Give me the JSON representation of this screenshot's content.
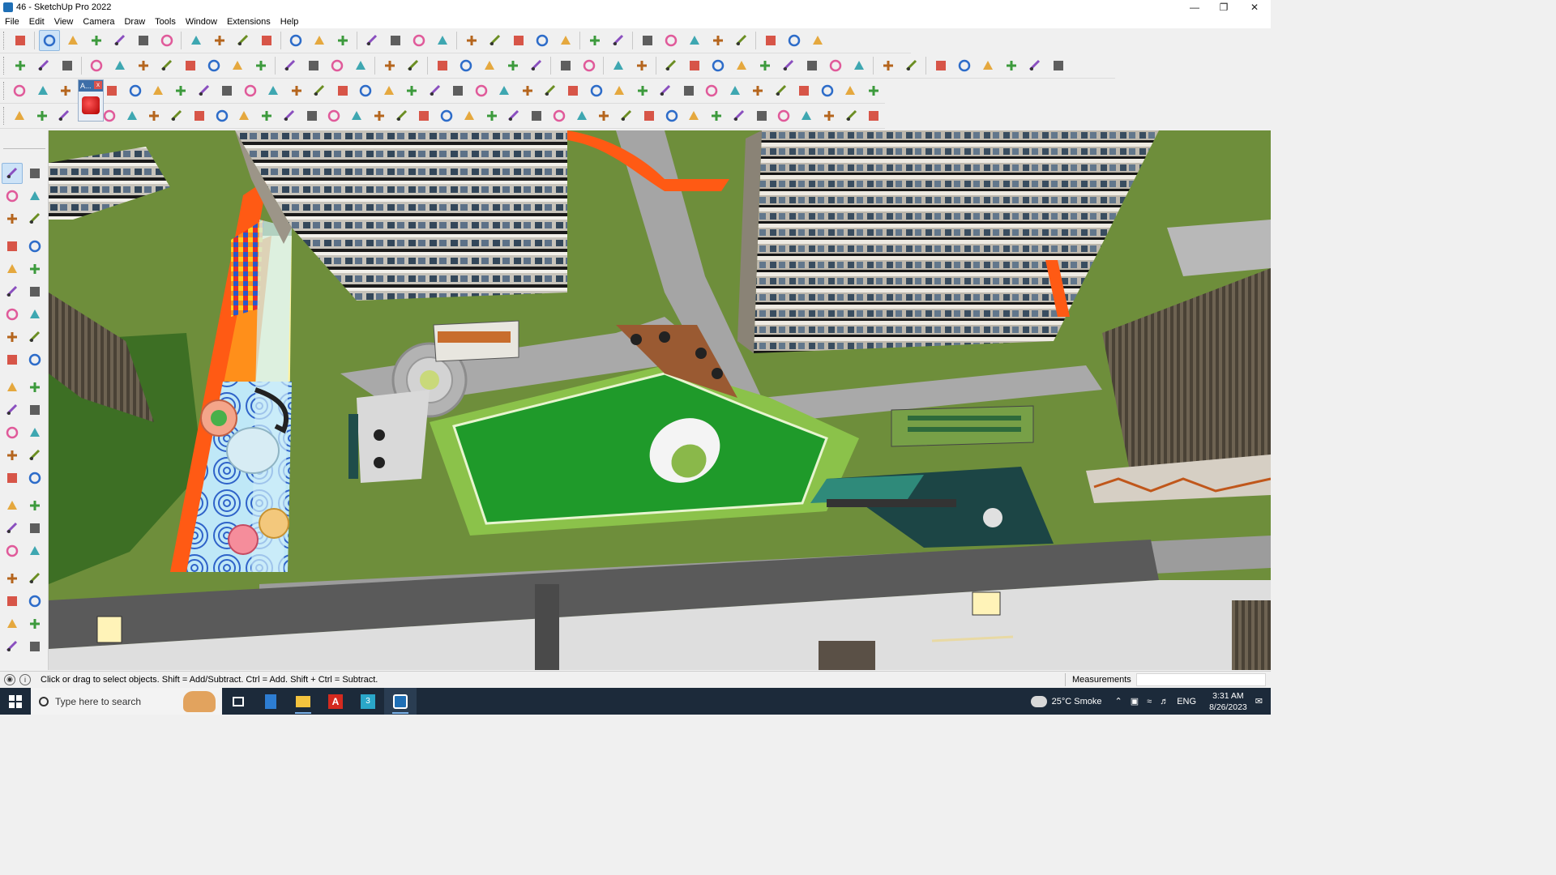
{
  "window": {
    "title": "46 - SketchUp Pro 2022",
    "controls": [
      "minimize-icon",
      "maximize-icon",
      "close-icon"
    ]
  },
  "menubar": {
    "items": [
      "File",
      "Edit",
      "View",
      "Camera",
      "Draw",
      "Tools",
      "Window",
      "Extensions",
      "Help"
    ]
  },
  "toolbar1": {
    "icons": [
      "zoom-extents-icon",
      "select-icon",
      "eraser-icon",
      "line-icon",
      "arc-icon",
      "rectangle-icon",
      "push-pull-icon",
      "follow-me-icon",
      "move-icon",
      "rotate-icon",
      "scale-icon",
      "tape-measure-icon",
      "text-icon",
      "paint-bucket-icon",
      "orbit-icon",
      "pan-icon",
      "zoom-icon",
      "zoom-window-icon",
      "section-plane-icon",
      "section-display-icon",
      "section-fill-icon",
      "section-cut-icon",
      "user-icon",
      "send-icon",
      "geo-location-icon",
      "axes-icon",
      "push-up-icon",
      "push-down-icon",
      "tag-icon",
      "sandbox-icon",
      "undo-icon",
      "redo-icon",
      "share-icon"
    ]
  },
  "toolbar2": {
    "icons": [
      "solid-icon",
      "outer-shell-icon",
      "intersect-icon",
      "extension-1-icon",
      "extension-2-icon",
      "extension-3-icon",
      "extension-4-icon",
      "extension-5-icon",
      "extension-6-icon",
      "extension-7-icon",
      "extension-8-icon",
      "soften-icon",
      "views-front-icon",
      "views-right-icon",
      "views-back-icon",
      "green-face-icon",
      "plant-icon",
      "house-1-icon",
      "house-2-icon",
      "house-3-icon",
      "house-4-icon",
      "house-5-icon",
      "fredoscale-icon",
      "hand-icon",
      "pencil-tool-icon",
      "circle-shape-icon",
      "polygon-shape-icon",
      "ellipse-shape-icon",
      "parallelogram-shape-icon",
      "curve-shape-icon",
      "spiral-shape-icon",
      "freehand-shape-icon",
      "blob-shape-icon",
      "tube-shape-icon",
      "measure-red-icon",
      "eraser-pink-icon",
      "material-1-icon",
      "material-2-icon",
      "material-3-icon",
      "material-4-icon",
      "material-5-icon",
      "material-6-icon",
      "material-7-icon"
    ]
  },
  "toolbar3": {
    "icons": [
      "face-blue-icon",
      "face-diamond-icon",
      "face-yellow-icon",
      "layer-toggle-icon",
      "pink-face-icon",
      "layer-icon",
      "orange-arc-icon",
      "red-square-icon",
      "stair-icon",
      "frame-icon",
      "wood-icon",
      "cable-icon",
      "hook-icon",
      "node-icon",
      "cross-plus-icon",
      "green-plus-icon",
      "blue-cross-icon",
      "cone-icon",
      "fountain-icon",
      "warning-icon",
      "arc-orange-icon",
      "chain-icon",
      "knot-icon",
      "star-icon",
      "box-icon",
      "refresh-icon",
      "puzzle-icon",
      "pivot-icon",
      "bevel-icon",
      "joint-icon",
      "gear-wheel-icon",
      "stair-case-icon",
      "grid-orange-icon",
      "grid-yellow-icon",
      "grid-small-icon",
      "x-red-icon",
      "dotted-arc-icon",
      "component-icon"
    ]
  },
  "toolbar3_popup": {
    "label": "A...",
    "icon": "red-cube-icon"
  },
  "toolbar4": {
    "icons": [
      "path-icon",
      "red-curve-icon",
      "red-car-icon",
      "cube-outline-1-icon",
      "cube-outline-2-icon",
      "cube-outline-3-icon",
      "bend-icon",
      "spin-icon",
      "angle-icon",
      "corner-icon",
      "corner-2-icon",
      "red-line-icon",
      "swoop-icon",
      "fence-icon",
      "cone-red-icon",
      "fan-icon",
      "comb-icon",
      "scallop-icon",
      "leaf-icon",
      "shear-icon",
      "lines-icon",
      "slope-icon",
      "fork-icon",
      "branch-icon",
      "split-icon",
      "stairs-grey-icon",
      "ramp-icon",
      "tile-icon",
      "column-icon",
      "louver-icon",
      "hatch-1-icon",
      "hatch-2-icon",
      "hatch-3-icon",
      "hatch-4-icon",
      "fan-2-icon",
      "fan-3-icon",
      "fan-4-icon",
      "fan-5-icon",
      "shell-icon"
    ]
  },
  "left_toolbar": {
    "icons": [
      "select-arrow-icon",
      "orbit-select-icon",
      "paint-icon",
      "eraser-left-icon",
      "component-left-icon",
      "tape-left-icon",
      "pencil-left-icon",
      "freehand-left-icon",
      "rect-left-icon",
      "rotated-rect-icon",
      "circle-left-icon",
      "polygon-left-icon",
      "arc-left-icon",
      "arc2-left-icon",
      "arc3-left-icon",
      "pie-left-icon",
      "move-left-icon",
      "push-pull-left-icon",
      "rotate-left-icon",
      "follow-left-icon",
      "scale-left-icon",
      "offset-left-icon",
      "tape-measure-left-icon",
      "dimension-left-icon",
      "protractor-left-icon",
      "text-left-icon",
      "axes-left-icon",
      "3d-text-left-icon",
      "orbit-left-icon",
      "pan-left-icon",
      "zoom-left-icon",
      "zoom-window-left-icon",
      "zoom-extents-left-icon",
      "previous-left-icon",
      "position-camera-icon",
      "look-around-icon",
      "walk-icon",
      "section-left-icon",
      "section-plane-left-icon",
      "section-fill-left-icon",
      "section-display-left-icon",
      "section-cut-left-icon"
    ]
  },
  "statusbar": {
    "hint": "Click or drag to select objects. Shift = Add/Subtract. Ctrl = Add. Shift + Ctrl = Subtract.",
    "measurements_label": "Measurements",
    "measurements_value": ""
  },
  "taskbar": {
    "search_placeholder": "Type here to search",
    "apps": [
      "task-view-icon",
      "calculator-icon",
      "file-explorer-icon",
      "acrobat-icon",
      "app-3-icon",
      "sketchup-icon"
    ],
    "weather": "25°C  Smoke",
    "language": "ENG",
    "time": "3:31 AM",
    "date": "8/26/2023"
  },
  "colors": {
    "toolbar_bg": "#f0f0f0",
    "viewport_grass": "#6f8f3b",
    "lawn": "#1f9a2a",
    "path_grey": "#a8a8a8",
    "track_orange": "#ff5a14",
    "taskbar_bg": "#1c2a3a",
    "selected_blue": "#cde3f7"
  }
}
